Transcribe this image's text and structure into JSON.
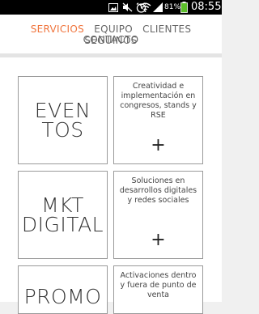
{
  "status_bar": {
    "battery_percent": "81%",
    "time": "08:55",
    "icons": [
      "photo-icon",
      "mute-icon",
      "alarm-icon",
      "wifi-icon",
      "signal-icon",
      "battery-icon"
    ]
  },
  "nav": {
    "items": [
      "SERVICIOS",
      "EQUIPO",
      "CLIENTES",
      "SEGUINOS",
      "CONTACTO"
    ],
    "active": "SERVICIOS",
    "colors": {
      "active": "#f0743c",
      "inactive": "#666666"
    }
  },
  "services": [
    {
      "title": "EVEN\nTOS",
      "description": "Creatividad e implementación en congresos, stands y RSE",
      "action": "+"
    },
    {
      "title": "MKT\nDIGITAL",
      "description": "Soluciones en desarrollos digitales y redes sociales",
      "action": "+"
    },
    {
      "title": "PROMO",
      "description": "Activaciones dentro y fuera de punto de venta",
      "action": "+"
    }
  ]
}
